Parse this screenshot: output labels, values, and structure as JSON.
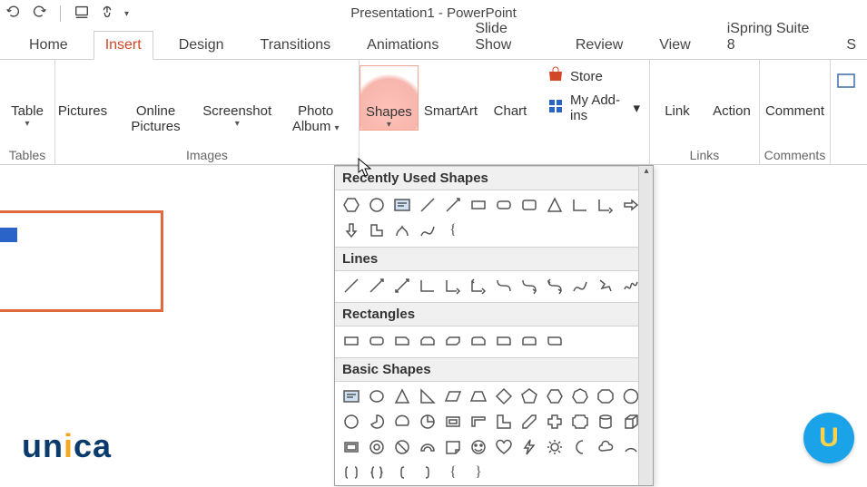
{
  "app": {
    "title": "Presentation1 - PowerPoint"
  },
  "tabs": [
    {
      "label": "Home"
    },
    {
      "label": "Insert"
    },
    {
      "label": "Design"
    },
    {
      "label": "Transitions"
    },
    {
      "label": "Animations"
    },
    {
      "label": "Slide Show"
    },
    {
      "label": "Review"
    },
    {
      "label": "View"
    },
    {
      "label": "iSpring Suite 8"
    },
    {
      "label": "S"
    }
  ],
  "active_tab": "Insert",
  "ribbon": {
    "tables": {
      "group": "Tables",
      "table": "Table"
    },
    "images": {
      "group": "Images",
      "pictures": "Pictures",
      "online_pictures": "Online Pictures",
      "screenshot": "Screenshot",
      "photo_album": "Photo Album"
    },
    "illustrations": {
      "shapes": "Shapes",
      "smartart": "SmartArt",
      "chart": "Chart"
    },
    "addins": {
      "store": "Store",
      "my_addins": "My Add-ins"
    },
    "links": {
      "group": "Links",
      "link": "Link",
      "action": "Action"
    },
    "comments": {
      "group": "Comments",
      "comment": "Comment"
    }
  },
  "gallery": {
    "sections": {
      "recent": "Recently Used Shapes",
      "lines": "Lines",
      "rect": "Rectangles",
      "basic": "Basic Shapes"
    }
  },
  "branding": {
    "logo_text": "unica",
    "badge": "U"
  }
}
